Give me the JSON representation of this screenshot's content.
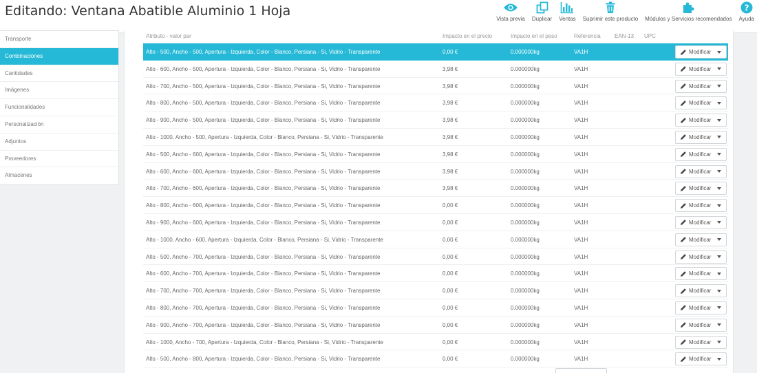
{
  "header": {
    "title": "Editando: Ventana Abatible Aluminio 1 Hoja",
    "toolbar": [
      {
        "label": "Vista previa",
        "icon": "eye-icon"
      },
      {
        "label": "Duplicar",
        "icon": "duplicate-icon"
      },
      {
        "label": "Ventas",
        "icon": "bar-chart-icon"
      },
      {
        "label": "Suprimir este producto",
        "icon": "trash-icon"
      },
      {
        "label": "Módulos y Servicios recomendados",
        "icon": "puzzle-icon"
      },
      {
        "label": "Ayuda",
        "icon": "help-icon"
      }
    ]
  },
  "sidebar": {
    "items": [
      {
        "label": "Transporte",
        "active": false
      },
      {
        "label": "Combinaciones",
        "active": true
      },
      {
        "label": "Cantidades",
        "active": false
      },
      {
        "label": "Imágenes",
        "active": false
      },
      {
        "label": "Funcionalidades",
        "active": false
      },
      {
        "label": "Personalización",
        "active": false
      },
      {
        "label": "Adjuntos",
        "active": false
      },
      {
        "label": "Proveedores",
        "active": false
      },
      {
        "label": "Almacenes",
        "active": false
      }
    ]
  },
  "table": {
    "headers": {
      "attribute": "Atributo - valor par",
      "price": "Impacto en el precio",
      "weight": "Impacto en el peso",
      "reference": "Referencia",
      "ean": "EAN-13",
      "upc": "UPC"
    },
    "button_label": "Modificar",
    "rows": [
      {
        "attr": "Alto - 500, Ancho - 500, Apertura - Izquierda, Color - Blanco, Persiana - Si, Vidrio - Transparente",
        "price": "0,00 €",
        "weight": "0.000000kg",
        "ref": "VA1H",
        "selected": true
      },
      {
        "attr": "Alto - 600, Ancho - 500, Apertura - Izquierda, Color - Blanco, Persiana - Si, Vidrio - Transparente",
        "price": "3,98 €",
        "weight": "0.000000kg",
        "ref": "VA1H"
      },
      {
        "attr": "Alto - 700, Ancho - 500, Apertura - Izquierda, Color - Blanco, Persiana - Si, Vidrio - Transparente",
        "price": "3,98 €",
        "weight": "0.000000kg",
        "ref": "VA1H"
      },
      {
        "attr": "Alto - 800, Ancho - 500, Apertura - Izquierda, Color - Blanco, Persiana - Si, Vidrio - Transparente",
        "price": "3,98 €",
        "weight": "0.000000kg",
        "ref": "VA1H"
      },
      {
        "attr": "Alto - 900, Ancho - 500, Apertura - Izquierda, Color - Blanco, Persiana - Si, Vidrio - Transparente",
        "price": "3,98 €",
        "weight": "0.000000kg",
        "ref": "VA1H"
      },
      {
        "attr": "Alto - 1000, Ancho - 500, Apertura - Izquierda, Color - Blanco, Persiana - Si, Vidrio - Transparente",
        "price": "3,98 €",
        "weight": "0.000000kg",
        "ref": "VA1H"
      },
      {
        "attr": "Alto - 500, Ancho - 600, Apertura - Izquierda, Color - Blanco, Persiana - Si, Vidrio - Transparente",
        "price": "3,98 €",
        "weight": "0.000000kg",
        "ref": "VA1H"
      },
      {
        "attr": "Alto - 600, Ancho - 600, Apertura - Izquierda, Color - Blanco, Persiana - Si, Vidrio - Transparente",
        "price": "3,98 €",
        "weight": "0.000000kg",
        "ref": "VA1H"
      },
      {
        "attr": "Alto - 700, Ancho - 600, Apertura - Izquierda, Color - Blanco, Persiana - Si, Vidrio - Transparente",
        "price": "3,98 €",
        "weight": "0.000000kg",
        "ref": "VA1H"
      },
      {
        "attr": "Alto - 800, Ancho - 600, Apertura - Izquierda, Color - Blanco, Persiana - Si, Vidrio - Transparente",
        "price": "0,00 €",
        "weight": "0.000000kg",
        "ref": "VA1H"
      },
      {
        "attr": "Alto - 900, Ancho - 600, Apertura - Izquierda, Color - Blanco, Persiana - Si, Vidrio - Transparente",
        "price": "0,00 €",
        "weight": "0.000000kg",
        "ref": "VA1H"
      },
      {
        "attr": "Alto - 1000, Ancho - 600, Apertura - Izquierda, Color - Blanco, Persiana - Si, Vidrio - Transparente",
        "price": "0,00 €",
        "weight": "0.000000kg",
        "ref": "VA1H"
      },
      {
        "attr": "Alto - 500, Ancho - 700, Apertura - Izquierda, Color - Blanco, Persiana - Si, Vidrio - Transparente",
        "price": "0,00 €",
        "weight": "0.000000kg",
        "ref": "VA1H"
      },
      {
        "attr": "Alto - 600, Ancho - 700, Apertura - Izquierda, Color - Blanco, Persiana - Si, Vidrio - Transparente",
        "price": "0,00 €",
        "weight": "0.000000kg",
        "ref": "VA1H"
      },
      {
        "attr": "Alto - 700, Ancho - 700, Apertura - Izquierda, Color - Blanco, Persiana - Si, Vidrio - Transparente",
        "price": "0,00 €",
        "weight": "0.000000kg",
        "ref": "VA1H"
      },
      {
        "attr": "Alto - 800, Ancho - 700, Apertura - Izquierda, Color - Blanco, Persiana - Si, Vidrio - Transparente",
        "price": "0,00 €",
        "weight": "0.000000kg",
        "ref": "VA1H"
      },
      {
        "attr": "Alto - 900, Ancho - 700, Apertura - Izquierda, Color - Blanco, Persiana - Si, Vidrio - Transparente",
        "price": "0,00 €",
        "weight": "0.000000kg",
        "ref": "VA1H"
      },
      {
        "attr": "Alto - 1000, Ancho - 700, Apertura - Izquierda, Color - Blanco, Persiana - Si, Vidrio - Transparente",
        "price": "0,00 €",
        "weight": "0.000000kg",
        "ref": "VA1H"
      },
      {
        "attr": "Alto - 500, Ancho - 800, Apertura - Izquierda, Color - Blanco, Persiana - Si, Vidrio - Transparente",
        "price": "0,00 €",
        "weight": "0.000000kg",
        "ref": "VA1H"
      }
    ]
  },
  "colors": {
    "accent": "#25b9d7",
    "icon": "#25b9d7"
  }
}
